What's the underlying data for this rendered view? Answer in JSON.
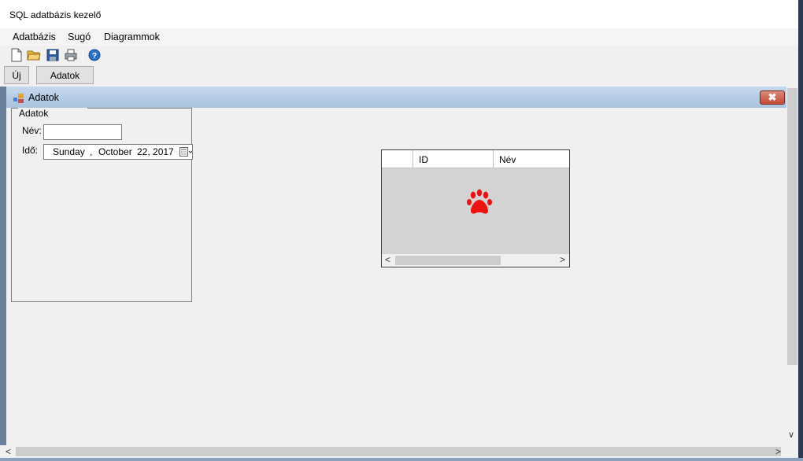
{
  "window": {
    "title": "SQL adatbázis kezelő"
  },
  "menu": {
    "items": [
      "Adatbázis",
      "Sugó",
      "Diagrammok"
    ]
  },
  "toolbar": {
    "icons": [
      "new-document-icon",
      "open-folder-icon",
      "save-icon",
      "print-icon",
      "help-icon"
    ]
  },
  "buttons": {
    "new_label": "Új",
    "data_label": "Adatok"
  },
  "child": {
    "title": "Adatok",
    "close_glyph": "✖",
    "group": {
      "label": "Adatok",
      "name_label": "Név:",
      "name_value": "",
      "time_label": "Idő:",
      "date": {
        "weekday": "Sunday",
        "comma": ",",
        "month": "October",
        "day_year": "22, 2017"
      }
    },
    "grid": {
      "columns": [
        "ID",
        "Név"
      ],
      "rows": []
    }
  },
  "colors": {
    "title_gradient_top": "#c6d8ec",
    "close_red": "#c24b34",
    "paw": "#ee1111"
  }
}
